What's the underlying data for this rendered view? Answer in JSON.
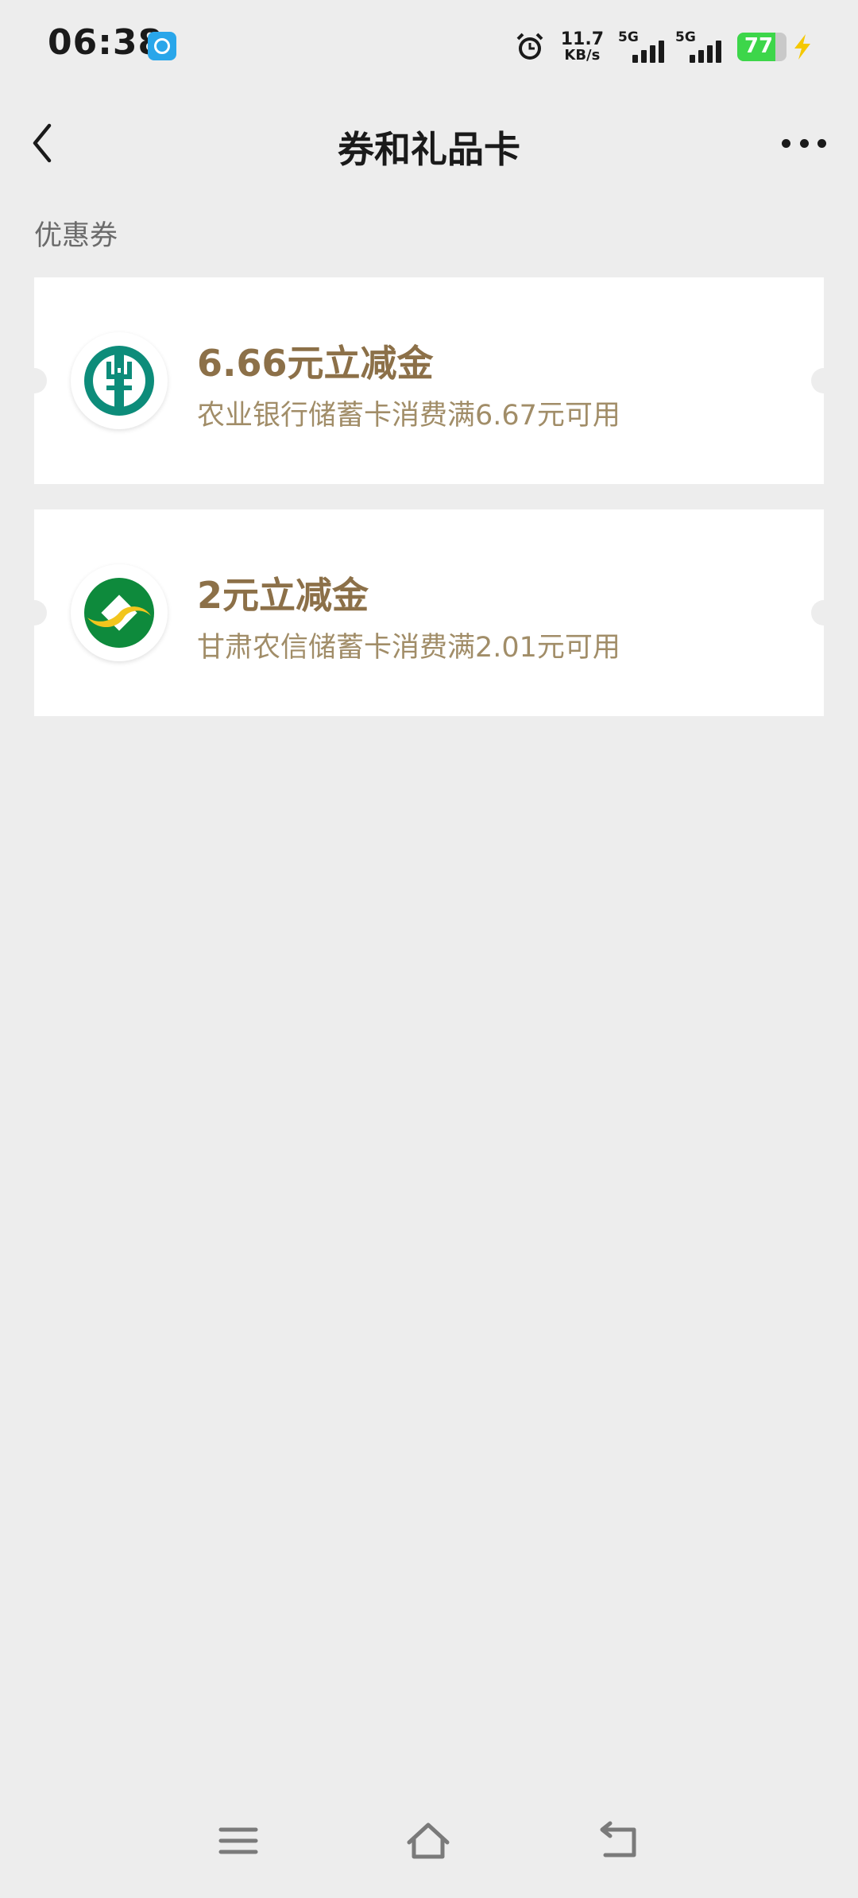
{
  "status_bar": {
    "time": "06:38",
    "net_speed_value": "11.7",
    "net_speed_unit": "KB/s",
    "signal_1": "5G",
    "signal_2": "5G",
    "battery": "77"
  },
  "nav": {
    "title": "券和礼品卡"
  },
  "section": {
    "title": "优惠券"
  },
  "coupons": [
    {
      "title": "6.66元立减金",
      "desc": "农业银行储蓄卡消费满6.67元可用",
      "logo": "abc-bank-logo"
    },
    {
      "title": "2元立减金",
      "desc": "甘肃农信储蓄卡消费满2.01元可用",
      "logo": "gansu-rural-credit-logo"
    }
  ],
  "colors": {
    "background": "#ededed",
    "coupon_title": "#8c7048",
    "coupon_desc": "#a18d68",
    "abc_green": "#0d8c7a",
    "rural_green": "#0e8a3c",
    "rural_yellow": "#f2c51d"
  }
}
